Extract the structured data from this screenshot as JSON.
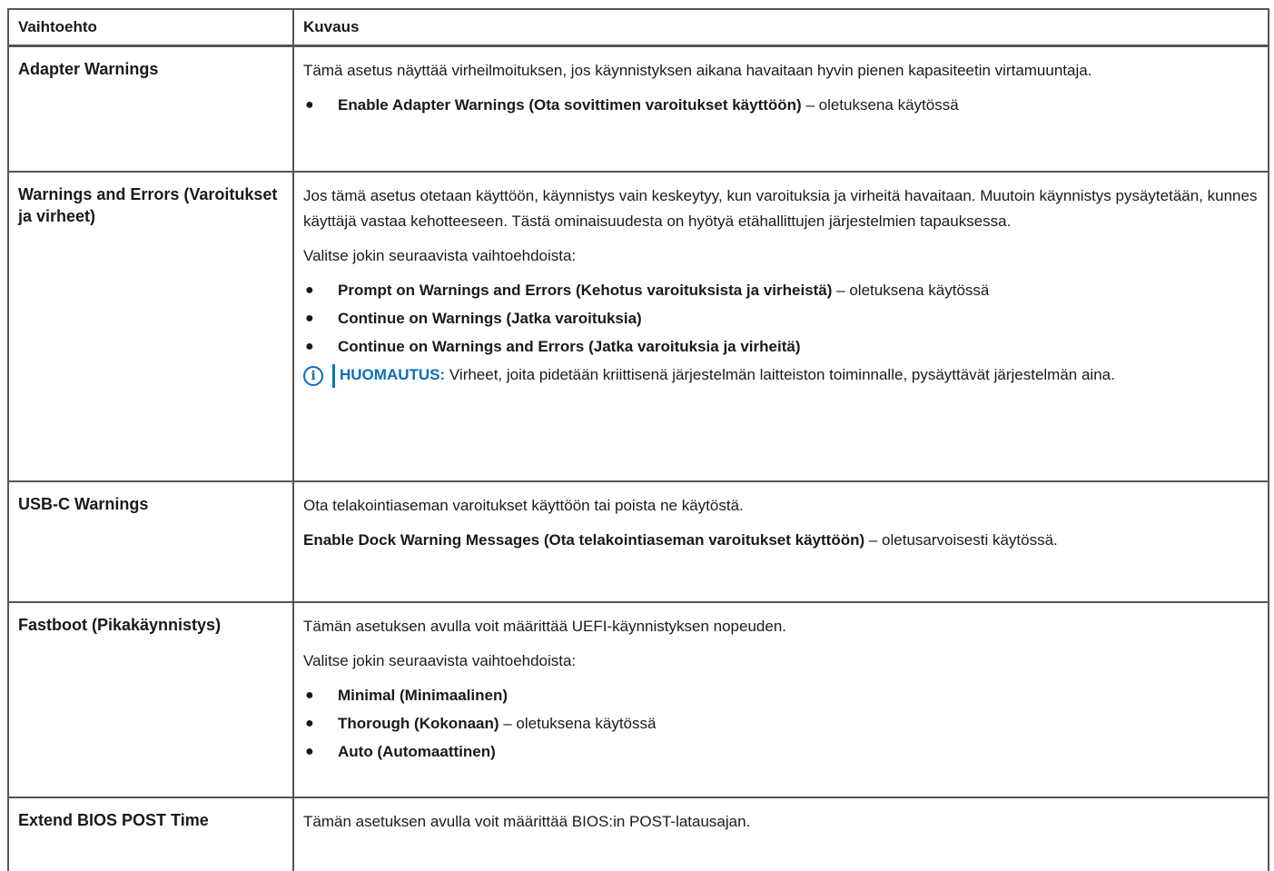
{
  "header": {
    "col1": "Vaihtoehto",
    "col2": "Kuvaus"
  },
  "rows": {
    "adapter": {
      "name": "Adapter Warnings",
      "desc": "Tämä asetus näyttää virheilmoituksen, jos käynnistyksen aikana havaitaan hyvin pienen kapasiteetin virtamuuntaja.",
      "item_bold": "Enable Adapter Warnings (Ota sovittimen varoitukset käyttöön)",
      "item_rest": " – oletuksena käytössä"
    },
    "warnings": {
      "name": "Warnings and Errors (Varoitukset ja virheet)",
      "desc": "Jos tämä asetus otetaan käyttöön, käynnistys vain keskeytyy, kun varoituksia ja virheitä havaitaan. Muutoin käynnistys pysäytetään, kunnes käyttäjä vastaa kehotteeseen. Tästä ominaisuudesta on hyötyä etähallittujen järjestelmien tapauksessa.",
      "choose": "Valitse jokin seuraavista vaihtoehdoista:",
      "item1_bold": "Prompt on Warnings and Errors (Kehotus varoituksista ja virheistä)",
      "item1_rest": " – oletuksena käytössä",
      "item2_bold": "Continue on Warnings (Jatka varoituksia)",
      "item3_bold": "Continue on Warnings and Errors (Jatka varoituksia ja virheitä)",
      "note_label": "HUOMAUTUS:",
      "note_text": " Virheet, joita pidetään kriittisenä järjestelmän laitteiston toiminnalle, pysäyttävät järjestelmän aina."
    },
    "usbc": {
      "name": "USB-C Warnings",
      "desc": "Ota telakointiaseman varoitukset käyttöön tai poista ne käytöstä.",
      "detail_bold": "Enable Dock Warning Messages (Ota telakointiaseman varoitukset käyttöön)",
      "detail_rest": " – oletusarvoisesti käytössä."
    },
    "fastboot": {
      "name": "Fastboot (Pikakäynnistys)",
      "desc": "Tämän asetuksen avulla voit määrittää UEFI-käynnistyksen nopeuden.",
      "choose": "Valitse jokin seuraavista vaihtoehdoista:",
      "item1_bold": "Minimal (Minimaalinen)",
      "item2_bold": "Thorough (Kokonaan)",
      "item2_rest": " – oletuksena käytössä",
      "item3_bold": "Auto (Automaattinen)"
    },
    "extend": {
      "name": "Extend BIOS POST Time",
      "desc": "Tämän asetuksen avulla voit määrittää BIOS:in POST-latausajan."
    }
  },
  "bullet_glyph": "●",
  "note_icon_glyph": "i"
}
